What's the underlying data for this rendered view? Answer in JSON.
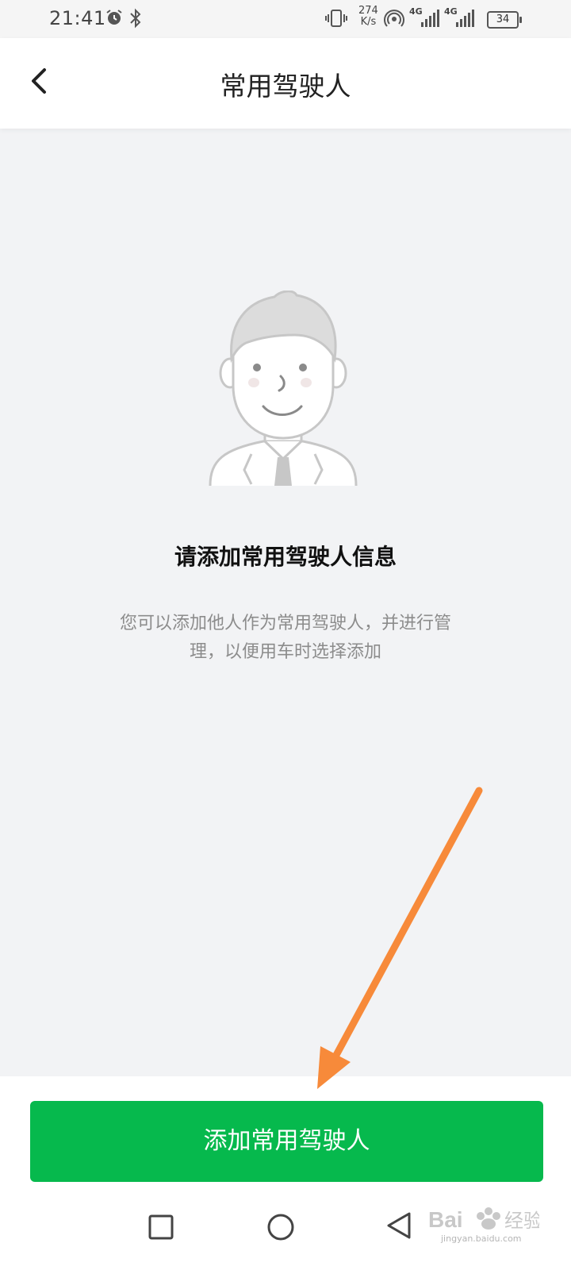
{
  "status_bar": {
    "time": "21:41",
    "net_speed_value": "274",
    "net_speed_unit": "K/s",
    "sim1_label": "4G",
    "sim2_label": "4G",
    "battery": "34"
  },
  "nav": {
    "title": "常用驾驶人"
  },
  "empty_state": {
    "title": "请添加常用驾驶人信息",
    "description": "您可以添加他人作为常用驾驶人，并进行管理，以便用车时选择添加"
  },
  "primary_action": {
    "label": "添加常用驾驶人"
  },
  "watermark": {
    "text": "jingyan.baidu.com"
  },
  "colors": {
    "accent": "#06b94d",
    "background": "#f2f3f5",
    "annotation_arrow": "#f78a3a"
  },
  "icons": {
    "back": "chevron-left-icon",
    "illustration": "person-avatar-illustration",
    "sys_recent": "square-icon",
    "sys_home": "circle-icon",
    "sys_back": "triangle-back-icon"
  }
}
